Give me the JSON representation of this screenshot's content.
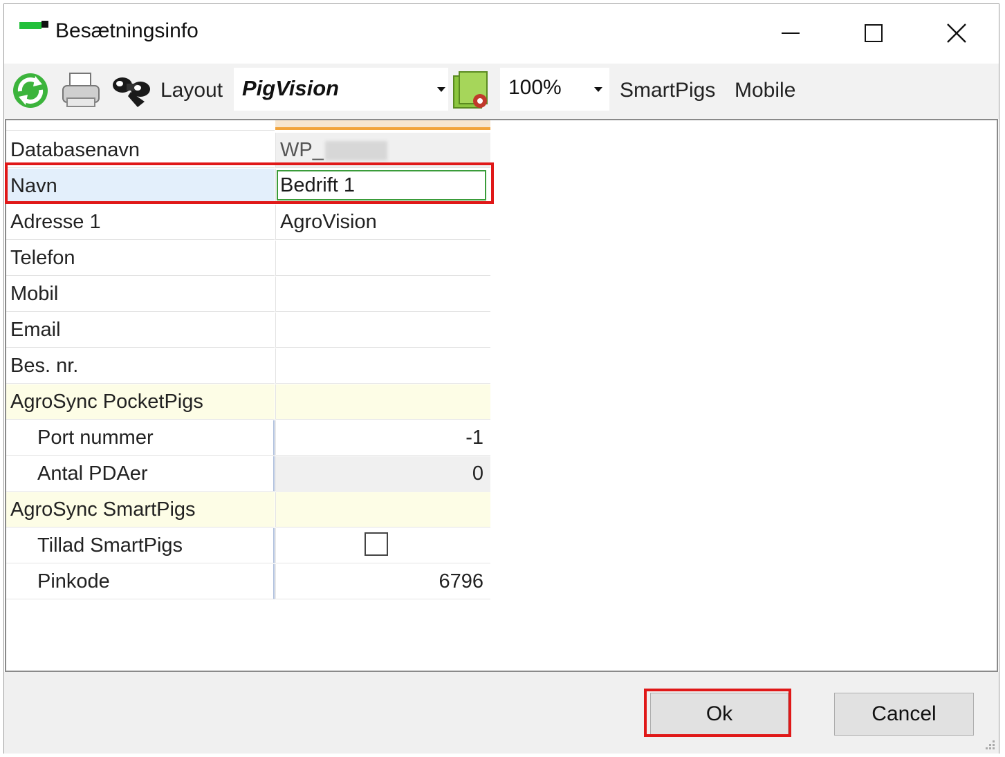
{
  "window": {
    "title": "Besætningsinfo"
  },
  "toolbar": {
    "refresh_icon": "refresh-icon",
    "print_icon": "printer-icon",
    "binoculars_icon": "binoculars-icon",
    "layout_label": "Layout",
    "layout_value": "PigVision",
    "settings_icon": "settings-document-icon",
    "zoom_value": "100%",
    "smartpigs_label": "SmartPigs",
    "mobile_label": "Mobile"
  },
  "properties": {
    "databasenavn_label": "Databasenavn",
    "databasenavn_value": "WP_",
    "navn_label": "Navn",
    "navn_value": "Bedrift 1",
    "adresse_label": "Adresse 1",
    "adresse_value": "AgroVision",
    "telefon_label": "Telefon",
    "telefon_value": "",
    "mobil_label": "Mobil",
    "mobil_value": "",
    "email_label": "Email",
    "email_value": "",
    "besnr_label": "Bes. nr.",
    "besnr_value": "",
    "pocketpigs_category": "AgroSync PocketPigs",
    "port_label": "Port nummer",
    "port_value": "-1",
    "pda_label": "Antal PDAer",
    "pda_value": "0",
    "smartpigs_category": "AgroSync SmartPigs",
    "tillad_label": "Tillad SmartPigs",
    "tillad_checked": false,
    "pinkode_label": "Pinkode",
    "pinkode_value": "6796"
  },
  "buttons": {
    "ok_label": "Ok",
    "cancel_label": "Cancel"
  },
  "colors": {
    "highlight_red": "#e01818",
    "edit_border_green": "#3a9c3a",
    "category_bg": "#fdfde6",
    "selected_row_bg": "#e3effb"
  }
}
